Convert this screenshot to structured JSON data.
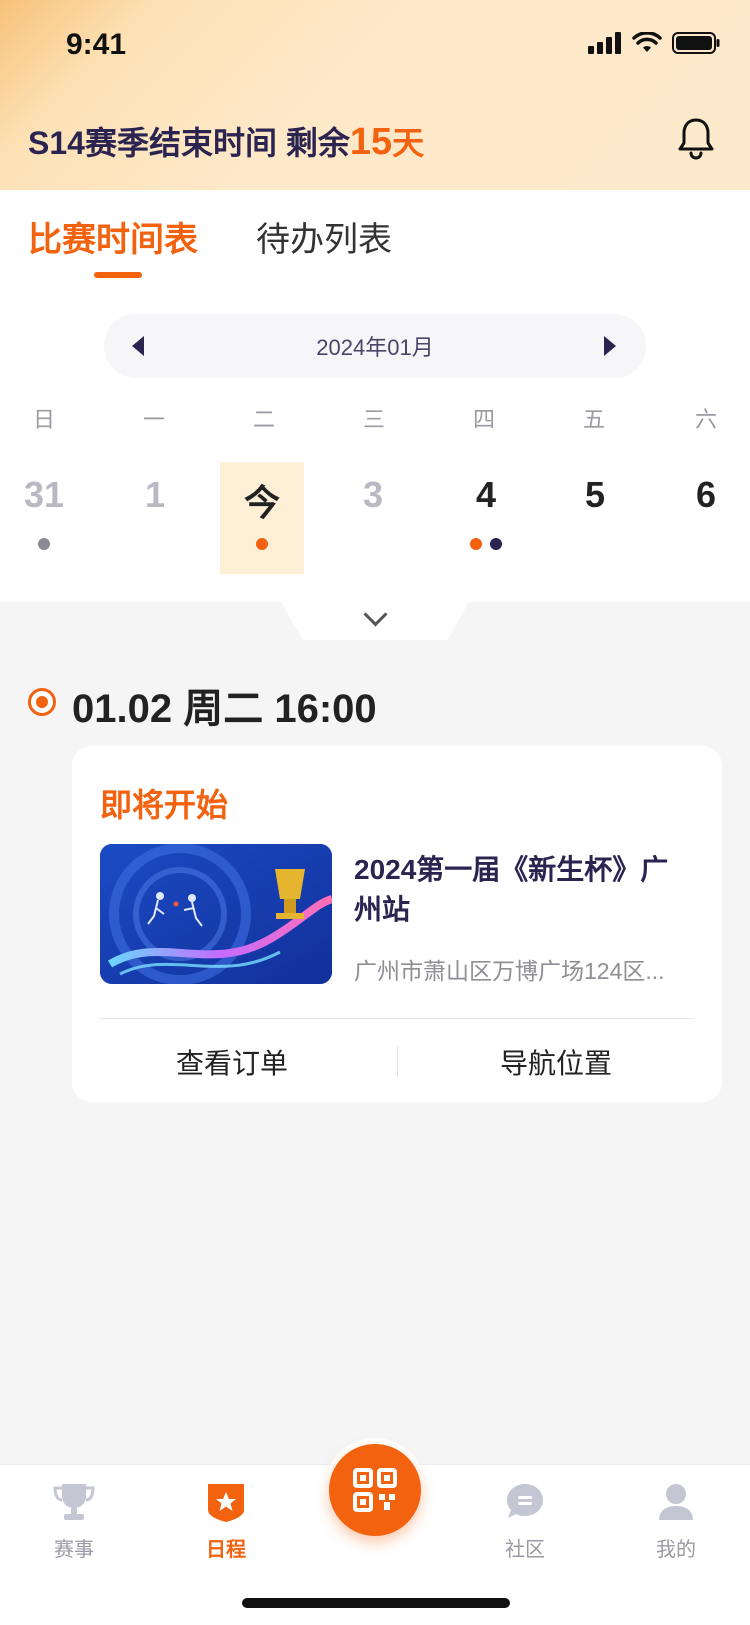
{
  "status_bar": {
    "time": "9:41"
  },
  "header": {
    "season_text": "S14赛季结束时间 剩余",
    "days_left": "15",
    "days_unit": "天"
  },
  "tabs": [
    {
      "label": "比赛时间表",
      "active": true
    },
    {
      "label": "待办列表",
      "active": false
    }
  ],
  "calendar": {
    "month_label": "2024年01月",
    "weekdays": [
      "日",
      "一",
      "二",
      "三",
      "四",
      "五",
      "六"
    ],
    "days": [
      {
        "label": "31",
        "muted": true,
        "dots": [
          "#8a8a96"
        ]
      },
      {
        "label": "1",
        "muted": true,
        "dots": []
      },
      {
        "label": "今",
        "today": true,
        "dots": [
          "#f2620f"
        ]
      },
      {
        "label": "3",
        "muted": true,
        "dots": []
      },
      {
        "label": "4",
        "dots": [
          "#f2620f",
          "#2b2450"
        ]
      },
      {
        "label": "5",
        "dots": []
      },
      {
        "label": "6",
        "dots": []
      }
    ]
  },
  "event": {
    "datetime": "01.02 周二 16:00",
    "status": "即将开始",
    "title": "2024第一届《新生杯》广州站",
    "address": "广州市萧山区万博广场124区...",
    "view_order_label": "查看订单",
    "navigate_label": "导航位置"
  },
  "bottom_nav": [
    {
      "label": "赛事",
      "icon": "trophy-icon"
    },
    {
      "label": "日程",
      "icon": "schedule-star-icon",
      "active": true
    },
    {
      "label": "",
      "icon": "qr-code-icon"
    },
    {
      "label": "社区",
      "icon": "chat-bubble-icon"
    },
    {
      "label": "我的",
      "icon": "profile-icon"
    }
  ],
  "colors": {
    "accent": "#f2620f",
    "navy": "#2b2450",
    "today_bg": "#fdeed6"
  }
}
